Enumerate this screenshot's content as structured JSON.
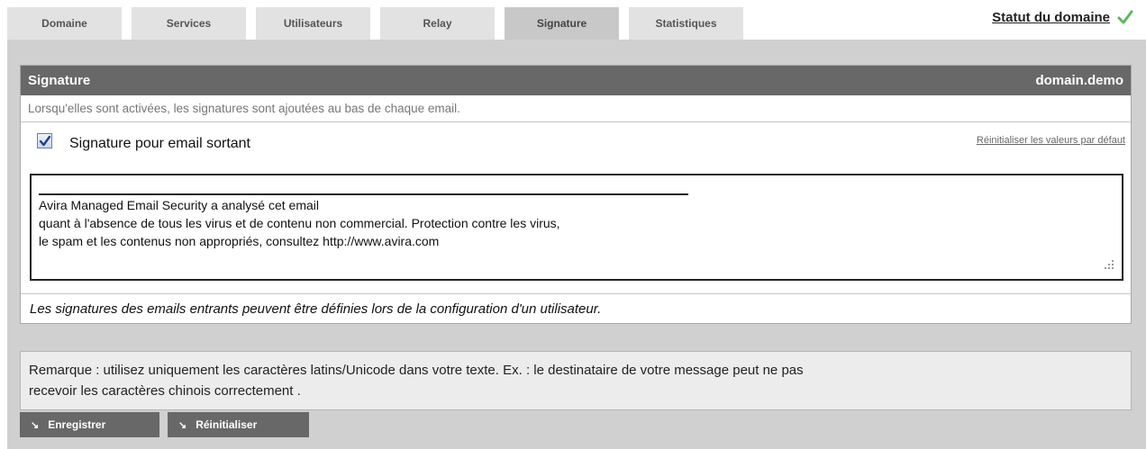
{
  "tabs": [
    {
      "label": "Domaine"
    },
    {
      "label": "Services"
    },
    {
      "label": "Utilisateurs"
    },
    {
      "label": "Relay"
    },
    {
      "label": "Signature"
    },
    {
      "label": "Statistiques"
    }
  ],
  "active_tab": "Signature",
  "status": {
    "label": "Statut du domaine",
    "icon": "check-icon",
    "color": "#5cb85c"
  },
  "panel": {
    "title": "Signature",
    "domain": "domain.demo",
    "description": "Lorsqu'elles sont activées, les signatures sont ajoutées au bas de chaque email.",
    "outgoing_checkbox": {
      "label": "Signature pour email sortant",
      "checked": true
    },
    "reset_link": "Réinitialiser les valeurs par défaut",
    "signature_text": [
      "Avira Managed Email Security a analysé cet email",
      "quant à l'absence de tous les virus et de contenu non commercial. Protection contre les virus,",
      "le spam et les contenus non appropriés, consultez http://www.avira.com"
    ],
    "incoming_note": "Les signatures des emails entrants peuvent être définies lors de la configuration d'un utilisateur."
  },
  "note": {
    "line1": "Remarque : utilisez uniquement les caractères latins/Unicode dans votre texte. Ex. : le destinataire de votre message peut ne pas",
    "line2": "recevoir les caractères chinois correctement ."
  },
  "buttons": {
    "save": "Enregistrer",
    "reset": "Réinitialiser",
    "arrow": "↘"
  },
  "colors": {
    "header_bg": "#686868",
    "body_bg": "#d0d0d0",
    "tab_bg": "#e2e2e2",
    "tab_active_bg": "#c8c8c8"
  }
}
